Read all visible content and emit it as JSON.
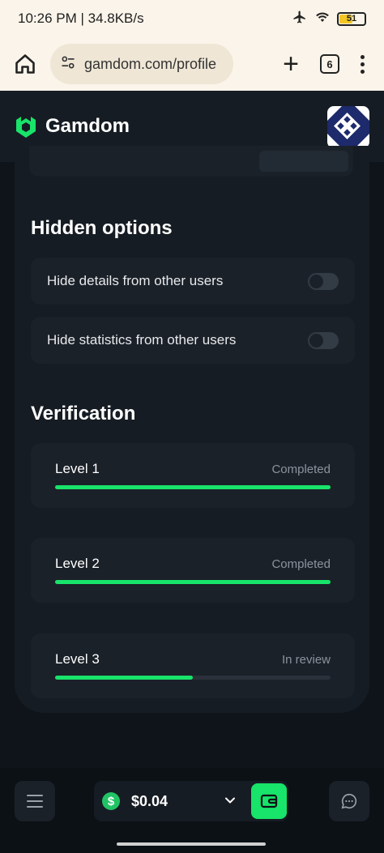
{
  "status_bar": {
    "time_speed": "10:26 PM | 34.8KB/s",
    "battery": "51"
  },
  "browser": {
    "url": "gamdom.com/profile",
    "tab_count": "6"
  },
  "site": {
    "logo_text": "Gamdom",
    "brand_color": "#18e36a"
  },
  "hidden_options": {
    "title": "Hidden options",
    "items": [
      {
        "label": "Hide details from other users",
        "enabled": false
      },
      {
        "label": "Hide statistics from other users",
        "enabled": false
      }
    ]
  },
  "verification": {
    "title": "Verification",
    "levels": [
      {
        "name": "Level 1",
        "status": "Completed",
        "progress": 1.0
      },
      {
        "name": "Level 2",
        "status": "Completed",
        "progress": 1.0
      },
      {
        "name": "Level 3",
        "status": "In review",
        "progress": 0.5
      }
    ]
  },
  "bottom_bar": {
    "balance": "$0.04",
    "currency_symbol": "$"
  },
  "icons": [
    "home-icon",
    "tune-icon",
    "plus-icon",
    "kebab-icon",
    "airplane-icon",
    "wifi-icon",
    "battery-icon",
    "gamdom-logo-icon",
    "menu-icon",
    "chevron-down-icon",
    "wallet-icon",
    "chat-icon"
  ]
}
